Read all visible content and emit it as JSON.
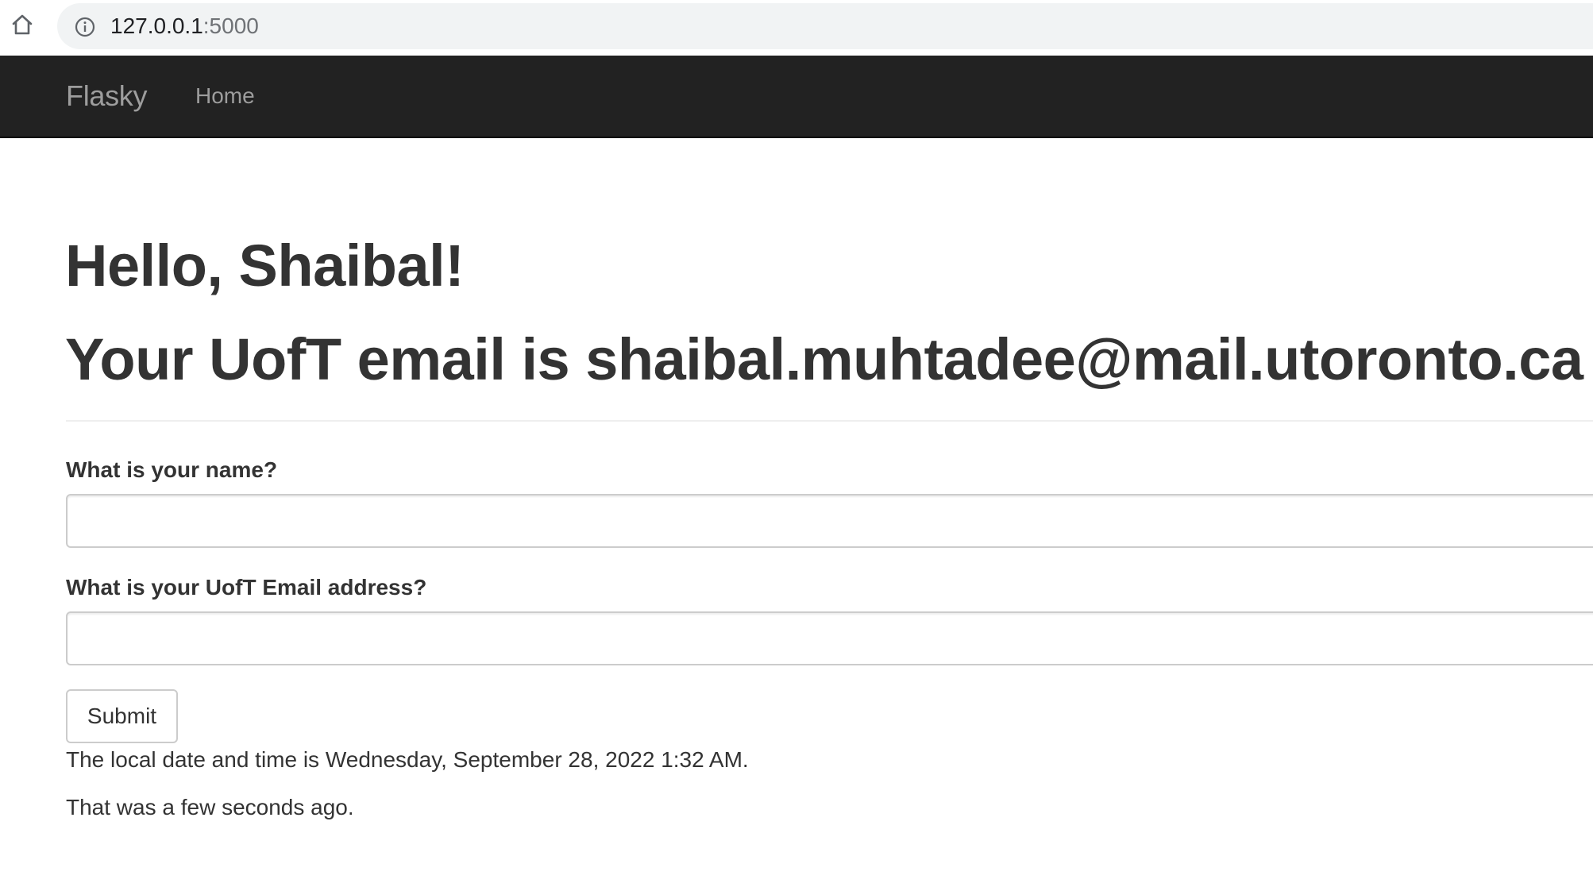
{
  "browser": {
    "url_host": "127.0.0.1",
    "url_port": ":5000",
    "icons": {
      "home": "home-icon",
      "site_info": "info-icon"
    }
  },
  "navbar": {
    "brand": "Flasky",
    "links": [
      {
        "label": "Home"
      }
    ],
    "background_color": "#222222",
    "text_color": "#9d9d9d"
  },
  "main": {
    "greeting": "Hello, Shaibal!",
    "email_heading": "Your UofT email is shaibal.muhtadee@mail.utoronto.ca",
    "form": {
      "name_label": "What is your name?",
      "name_value": "",
      "email_label": "What is your UofT Email address?",
      "email_value": "",
      "submit_label": "Submit"
    },
    "datetime_text": "The local date and time is Wednesday, September 28, 2022 1:32 AM.",
    "relative_time_text": "That was a few seconds ago."
  }
}
